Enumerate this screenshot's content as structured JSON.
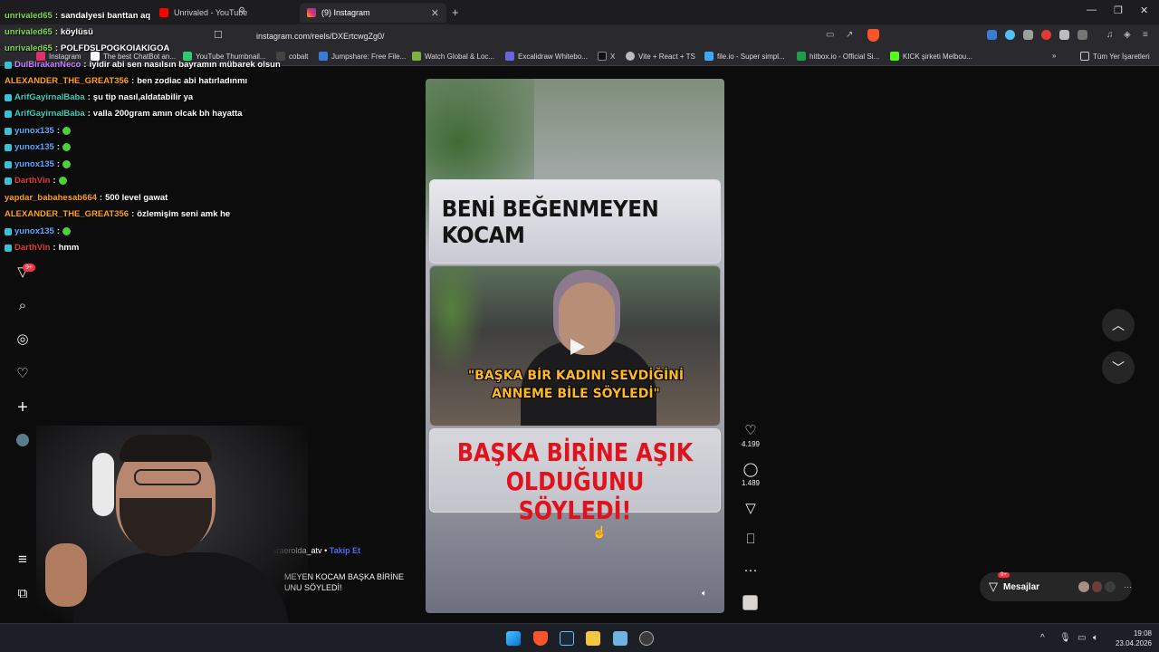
{
  "browser": {
    "tabs": [
      {
        "title": "Unrivaled - YouTube",
        "active": false,
        "favicon_color": "#ff0000"
      },
      {
        "title": "(9) Instagram",
        "active": true,
        "favicon_color": "#e1306c"
      }
    ],
    "url": "instagram.com/reels/DXErtcwgZg0/",
    "bookmarks": [
      {
        "label": "Instagram",
        "color": "#e1306c"
      },
      {
        "label": "The best ChatBot an...",
        "color": "#ffffff"
      },
      {
        "label": "YouTube Thumbnail...",
        "color": "#2ecc71"
      },
      {
        "label": "cobalt",
        "color": "#ffffff"
      },
      {
        "label": "Jumpshare: Free File...",
        "color": "#3a7bd5"
      },
      {
        "label": "Watch Global & Loc...",
        "color": "#7cb342"
      },
      {
        "label": "Excalidraw Whitebo...",
        "color": "#6965db"
      },
      {
        "label": "X",
        "color": "#ffffff"
      },
      {
        "label": "Vite + React + TS",
        "color": "#bbbbbb"
      },
      {
        "label": "file.io - Super simpl...",
        "color": "#3fa9f5"
      },
      {
        "label": "hitbox.io - Official Si...",
        "color": "#1e9e4a"
      },
      {
        "label": "KICK şirketi Melbou...",
        "color": "#53fc18"
      }
    ],
    "all_bookmarks": "Tüm Yer İşaretleri"
  },
  "chat": [
    {
      "user": "unrivaled65",
      "text": "sandalyesi banttan aq",
      "color": "#7ed957"
    },
    {
      "user": "unrivaled65",
      "text": "köylüsü",
      "color": "#7ed957"
    },
    {
      "user": "unrivaled65",
      "text": "POLFDSLPOGKOIAKIGOA",
      "color": "#7ed957"
    },
    {
      "user": "DulBirakanNeco",
      "text": "iyidir abi sen nasılsın bayramın mübarek olsun",
      "color": "#c77dff"
    },
    {
      "user": "ALEXANDER_THE_GREAT356",
      "text": "ben zodiac abi hatırladınmı",
      "color": "#ff9f1c"
    },
    {
      "user": "ArifGayirnalBaba",
      "text": "şu tip nasıl,aldatabilir ya",
      "color": "#35d0ba"
    },
    {
      "user": "ArifGayirnalBaba",
      "text": "valla 200gram amın olcak bh hayatta",
      "color": "#35d0ba"
    },
    {
      "user": "yunox135",
      "text": "",
      "color": "#5aa9ff"
    },
    {
      "user": "yunox135",
      "text": "",
      "color": "#5aa9ff"
    },
    {
      "user": "yunox135",
      "text": "",
      "color": "#5aa9ff"
    },
    {
      "user": "DarthVin",
      "text": "",
      "color": "#e23a3a"
    },
    {
      "user": "yapdar_babahesab664",
      "text": "500 level gawat",
      "color": "#ff9f1c"
    },
    {
      "user": "ALEXANDER_THE_GREAT356",
      "text": "özlemişim seni amk he",
      "color": "#ff9f1c"
    },
    {
      "user": "yunox135",
      "text": "",
      "color": "#5aa9ff"
    },
    {
      "user": "DarthVin",
      "text": "hmm",
      "color": "#e23a3a"
    }
  ],
  "ig": {
    "notifications_badge": "9+",
    "reel": {
      "top_title": "BENİ BEĞENMEYEN KOCAM",
      "mid_caption_1": "\"BAŞKA BİR KADINI SEVDİĞİNİ",
      "mid_caption_2": "ANNEME BİLE SÖYLEDİ\"",
      "bottom_line_1": "BAŞKA BİRİNE AŞIK",
      "bottom_line_2": "OLDUĞUNU SÖYLEDİ!"
    },
    "author": "esraerolda_atv",
    "separator": "•",
    "follow": "Takip Et",
    "caption_line_1": "MEYEN KOCAM BAŞKA BİRİNE",
    "caption_line_2": "UNU SÖYLEDİ!",
    "likes": "4.199",
    "comments": "1.489",
    "messages_label": "Mesajlar",
    "messages_badge": "9+"
  },
  "taskbar": {
    "time": "19:08",
    "date": "23.04.2026"
  }
}
